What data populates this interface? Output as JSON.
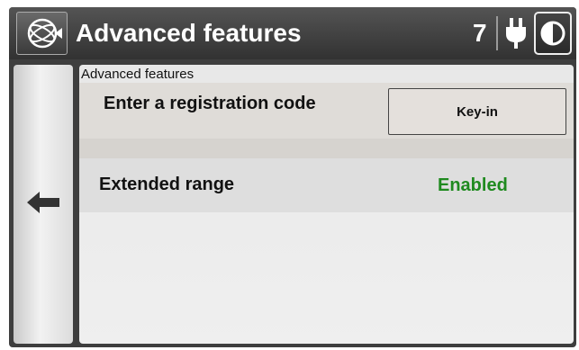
{
  "header": {
    "title": "Advanced features",
    "satellite_count": "7",
    "logo_icon": "globe-logo-icon",
    "power_icon": "power-plug-icon",
    "contrast_icon": "contrast-icon"
  },
  "back_button": {
    "icon": "arrow-left-icon"
  },
  "panel": {
    "title": "Advanced features",
    "rows": [
      {
        "label": "Enter a registration code",
        "button_label": "Key-in"
      },
      {
        "label": "Extended range",
        "status": "Enabled"
      }
    ]
  },
  "colors": {
    "header_bg": "#3c3c3c",
    "panel_bg": "#eaeaea",
    "status_enabled": "#1f8a1f"
  }
}
